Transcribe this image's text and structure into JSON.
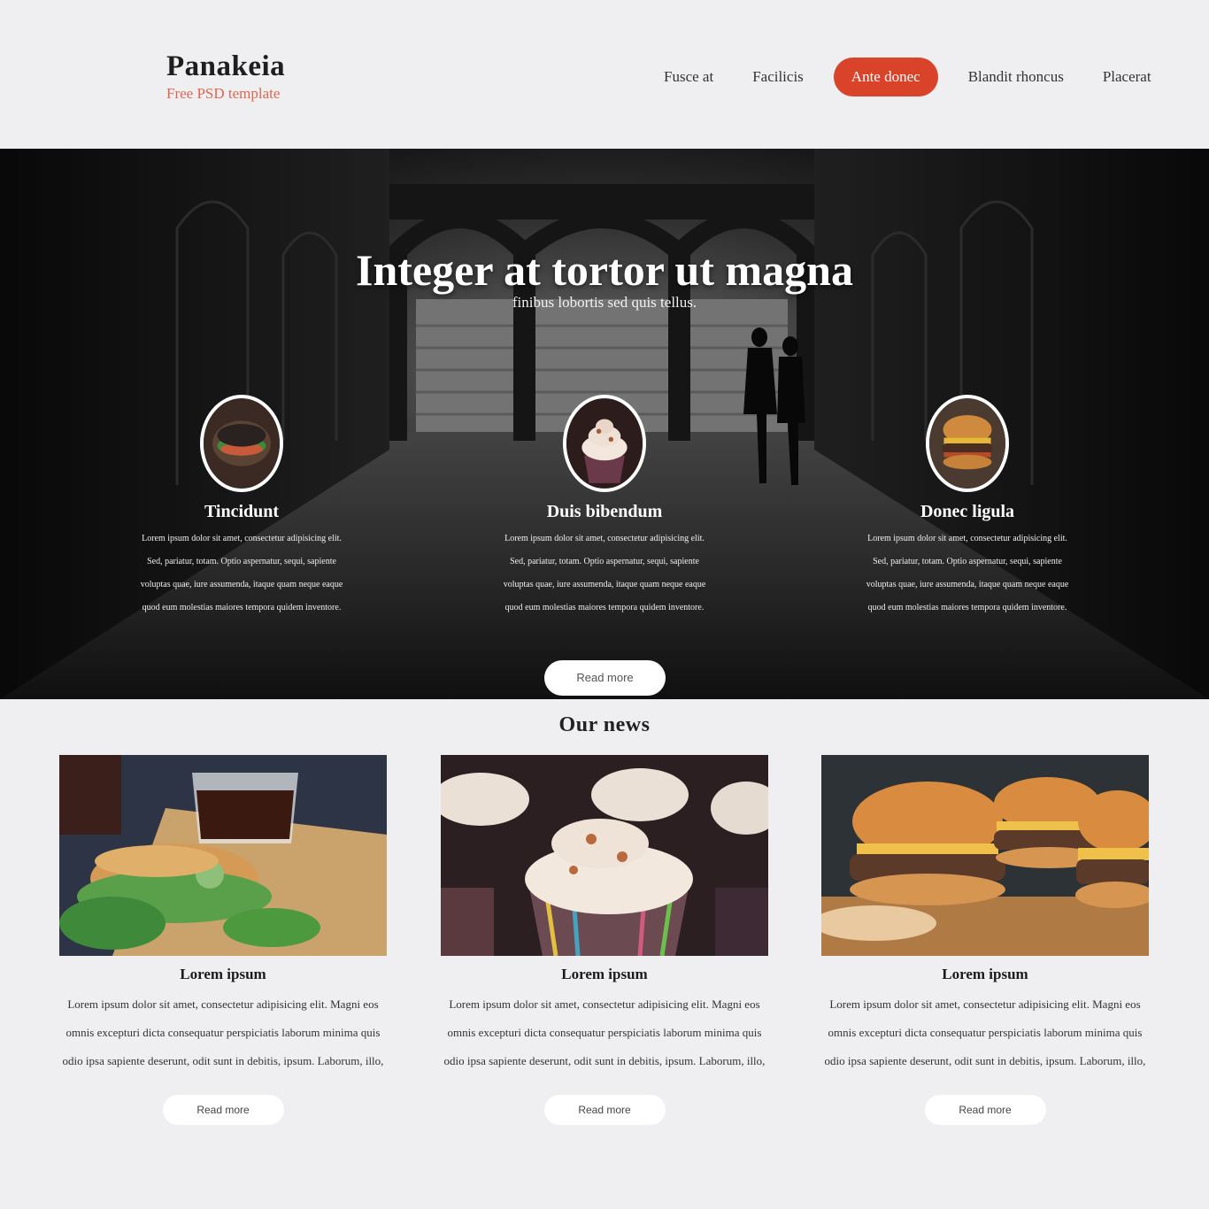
{
  "brand": {
    "title": "Panakeia",
    "subtitle": "Free PSD template",
    "accent": "#d9432a"
  },
  "nav": {
    "items": [
      {
        "label": "Fusce at",
        "active": false
      },
      {
        "label": "Facilicis",
        "active": false
      },
      {
        "label": "Ante donec",
        "active": true
      },
      {
        "label": "Blandit rhoncus",
        "active": false
      },
      {
        "label": "Placerat",
        "active": false
      }
    ]
  },
  "hero": {
    "title": "Integer at tortor ut magna",
    "subtitle": "finibus lobortis sed quis tellus.",
    "features": [
      {
        "title": "Tincidunt",
        "text": "Lorem ipsum dolor sit amet, consectetur adipisicing elit. Sed, pariatur, totam. Optio aspernatur, sequi, sapiente voluptas quae, iure assumenda, itaque quam neque eaque quod eum molestias maiores tempora quidem inventore.",
        "icon": "sandwich-image"
      },
      {
        "title": "Duis bibendum",
        "text": "Lorem ipsum dolor sit amet, consectetur adipisicing elit. Sed, pariatur, totam. Optio aspernatur, sequi, sapiente voluptas quae, iure assumenda, itaque quam neque eaque quod eum molestias maiores tempora quidem inventore.",
        "icon": "cupcake-image"
      },
      {
        "title": "Donec ligula",
        "text": "Lorem ipsum dolor sit amet, consectetur adipisicing elit. Sed, pariatur, totam. Optio aspernatur, sequi, sapiente voluptas quae, iure assumenda, itaque quam neque eaque quod eum molestias maiores tempora quidem inventore.",
        "icon": "burger-image"
      }
    ],
    "button": "Read more"
  },
  "news": {
    "title": "Our news",
    "cards": [
      {
        "title": "Lorem ipsum",
        "text": "Lorem ipsum dolor sit amet, consectetur adipisicing elit. Magni eos omnis excepturi dicta consequatur perspiciatis laborum minima quis odio ipsa sapiente deserunt, odit sunt in debitis, ipsum. Laborum, illo,",
        "button": "Read more"
      },
      {
        "title": "Lorem ipsum",
        "text": "Lorem ipsum dolor sit amet, consectetur adipisicing elit. Magni eos omnis excepturi dicta consequatur perspiciatis laborum minima quis odio ipsa sapiente deserunt, odit sunt in debitis, ipsum. Laborum, illo,",
        "button": "Read more"
      },
      {
        "title": "Lorem ipsum",
        "text": "Lorem ipsum dolor sit amet, consectetur adipisicing elit. Magni eos omnis excepturi dicta consequatur perspiciatis laborum minima quis odio ipsa sapiente deserunt, odit sunt in debitis, ipsum. Laborum, illo,",
        "button": "Read more"
      }
    ]
  }
}
